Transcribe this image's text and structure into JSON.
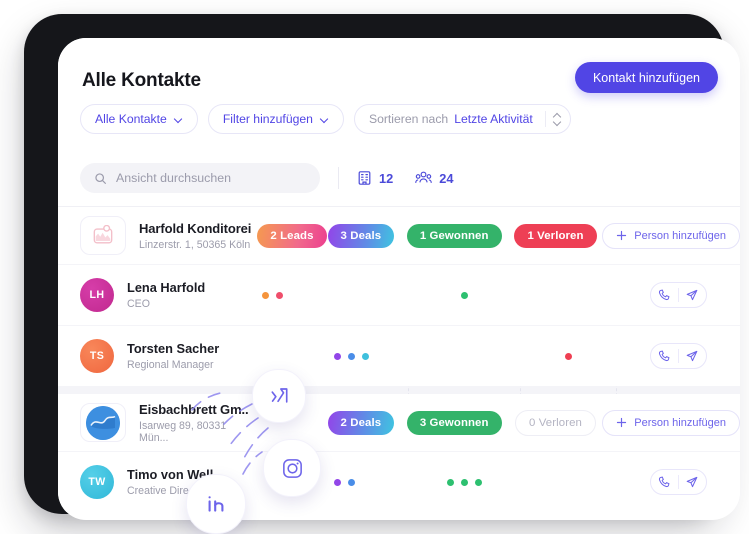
{
  "header": {
    "title": "Alle Kontakte",
    "primary_button": "Kontakt hinzufügen",
    "filters": [
      {
        "label": "Alle Kontakte",
        "icon": "chevron-down-icon"
      },
      {
        "label": "Filter hinzufügen",
        "icon": "chevron-down-icon"
      }
    ],
    "sort": {
      "prefix": "Sortieren nach",
      "value": "Letzte Aktivität",
      "icon": "sort-updown-icon"
    }
  },
  "toolbar": {
    "search_placeholder": "Ansicht durchsuchen",
    "search_value": "",
    "search_icon": "search-icon",
    "counters": [
      {
        "icon": "building-icon",
        "value": "12"
      },
      {
        "icon": "people-icon",
        "value": "24"
      }
    ]
  },
  "groups": [
    {
      "company": {
        "name": "Harfold Konditorei",
        "address": "Linzerstr. 1, 50365 Köln",
        "logo": "image-placeholder-icon",
        "leads_badge": {
          "label": "2 Leads",
          "style": "gradient-orange-pink"
        },
        "deals_badge": {
          "label": "3 Deals",
          "style": "gradient-purple-cyan"
        },
        "won_badge": {
          "label": "1 Gewonnen",
          "style": "green"
        },
        "lost_badge": {
          "label": "1 Verloren",
          "style": "red"
        },
        "add_person": "Person hinzufügen"
      },
      "people": [
        {
          "initials": "LH",
          "avatar_color": "#c8329b",
          "name": "Lena Harfold",
          "role": "CEO",
          "leads_dots": [
            "#f5943c",
            "#ef4e6b"
          ],
          "deals_dots": [],
          "won_dots": [
            "#2dc070"
          ],
          "lost_dots": [],
          "actions": [
            "phone-icon",
            "send-icon"
          ]
        },
        {
          "initials": "TS",
          "avatar_color": "#f4794a",
          "name": "Torsten Sacher",
          "role": "Regional Manager",
          "leads_dots": [],
          "deals_dots": [
            "#9246e8",
            "#4a8de8",
            "#3fc0dd"
          ],
          "won_dots": [],
          "lost_dots": [
            "#ef3f52"
          ],
          "actions": [
            "phone-icon",
            "send-icon"
          ]
        }
      ]
    },
    {
      "company": {
        "name": "Eisbachbrett Gm..",
        "address": "Isarweg 89, 80331 Mün...",
        "logo": "wave-circle-icon",
        "leads_badge": null,
        "deals_badge": {
          "label": "2 Deals",
          "style": "gradient-purple-cyan"
        },
        "won_badge": {
          "label": "3 Gewonnen",
          "style": "green"
        },
        "lost_badge": {
          "label": "0 Verloren",
          "style": "empty"
        },
        "add_person": "Person hinzufügen"
      },
      "people": [
        {
          "initials": "TW",
          "avatar_color": "#3fc0e0",
          "name": "Timo von Well",
          "role": "Creative Director",
          "leads_dots": [],
          "deals_dots": [
            "#9246e8",
            "#4a8de8"
          ],
          "won_dots": [
            "#2dc070",
            "#2dc070",
            "#2dc070"
          ],
          "lost_dots": [],
          "actions": [
            "phone-icon",
            "send-icon"
          ]
        }
      ]
    }
  ],
  "social_bubbles": [
    {
      "name": "xing-icon",
      "label": "XING"
    },
    {
      "name": "instagram-icon",
      "label": "Instagram"
    },
    {
      "name": "linkedin-icon",
      "label": "LinkedIn"
    }
  ],
  "colors": {
    "accent": "#5145e5",
    "green": "#34b36a",
    "red": "#ef3f52",
    "text": "#1b1c24",
    "muted": "#9c9cab",
    "frame": "#15161a"
  }
}
